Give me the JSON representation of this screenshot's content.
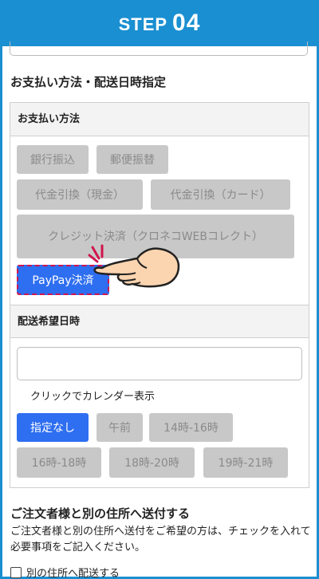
{
  "header": {
    "step_word": "STEP",
    "step_number": "04"
  },
  "section": {
    "title": "お支払い方法・配送日時指定"
  },
  "payment": {
    "heading": "お支払い方法",
    "options": [
      "銀行振込",
      "郵便振替",
      "代金引換（現金）",
      "代金引換（カード）",
      "クレジット決済（クロネコWEBコレクト）",
      "PayPay決済"
    ]
  },
  "delivery": {
    "heading": "配送希望日時",
    "date_value": "",
    "calendar_hint": "クリックでカレンダー表示",
    "times": [
      "指定なし",
      "午前",
      "14時-16時",
      "16時-18時",
      "18時-20時",
      "19時-21時"
    ]
  },
  "shipping": {
    "title": "ご注文者様と別の住所へ送付する",
    "description": "ご注文者様と別の住所へ送付をご希望の方は、チェックを入れて必要事項をご記入ください。",
    "checkbox_label": "別の住所へ配送する"
  },
  "colors": {
    "header": "#1a8fd1",
    "active": "#2e6ef0",
    "highlight": "#d0154c",
    "disabled": "#c8c8c8"
  },
  "icons": [
    "pointing-hand-icon"
  ]
}
